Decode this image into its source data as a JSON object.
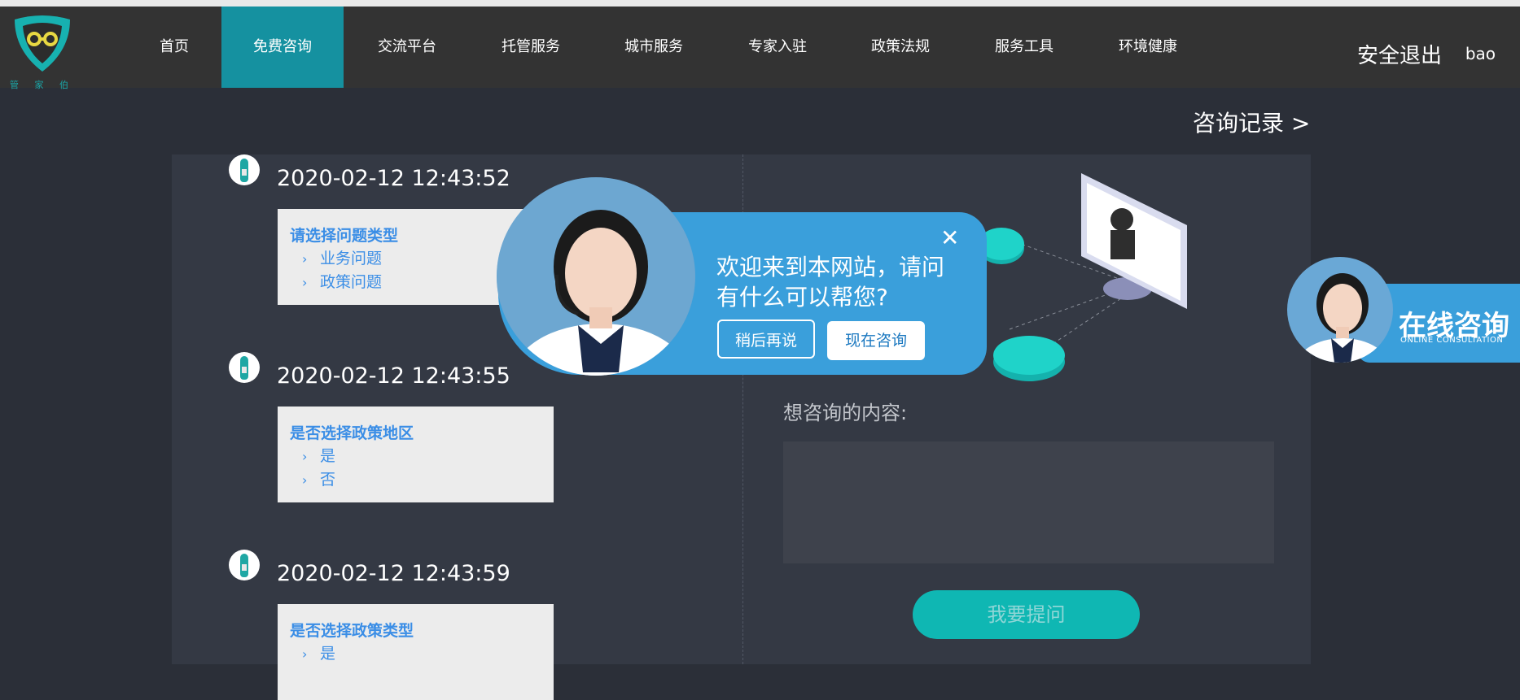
{
  "logo": {
    "text": "管 家 伯"
  },
  "nav": {
    "items": [
      {
        "label": "首页"
      },
      {
        "label": "免费咨询"
      },
      {
        "label": "交流平台"
      },
      {
        "label": "托管服务"
      },
      {
        "label": "城市服务"
      },
      {
        "label": "专家入驻"
      },
      {
        "label": "政策法规"
      },
      {
        "label": "服务工具"
      },
      {
        "label": "环境健康"
      }
    ],
    "active_index": 1,
    "logout_label": "安全退出",
    "username": "bao"
  },
  "records_link": "咨询记录  >",
  "messages": [
    {
      "time": "2020-02-12 12:43:52",
      "title": "请选择问题类型",
      "options": [
        "业务问题",
        "政策问题"
      ]
    },
    {
      "time": "2020-02-12 12:43:55",
      "title": "是否选择政策地区",
      "options": [
        "是",
        "否"
      ]
    },
    {
      "time": "2020-02-12 12:43:59",
      "title": "是否选择政策类型",
      "options": [
        "是"
      ]
    }
  ],
  "chevron_icon": "chevron-right-icon",
  "popup": {
    "text": "欢迎来到本网站，请问有什么可以帮您?",
    "close_glyph": "✕",
    "later_button": "稍后再说",
    "now_button": "现在咨询"
  },
  "form": {
    "content_label": "想咨询的内容:",
    "content_value": "",
    "submit_label": "我要提问"
  },
  "online_consult": {
    "title": "在线咨询",
    "subtitle": "ONLINE CONSULTATION"
  },
  "colors": {
    "nav_active": "#1591a0",
    "accent_blue": "#3a9fdb",
    "submit_teal": "#0fb7b3",
    "card_text": "#3b8ee6"
  }
}
